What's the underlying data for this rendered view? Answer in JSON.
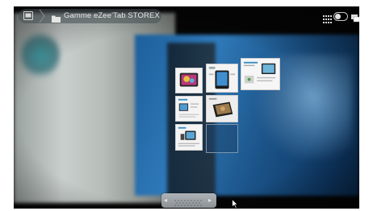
{
  "topbar": {
    "home_icon": "album-icon",
    "separator_icon": "chevron-right-icon",
    "folder_icon": "folder-icon",
    "breadcrumb": "Gamme eZee'Tab STOREX",
    "grid_icon": "grid-view-icon",
    "toggle_icon": "view-toggle",
    "menu_icon": "menu-icon"
  },
  "stack": {
    "thumbnails": [
      {
        "name": "tablet-photo-1"
      },
      {
        "name": "tablet-photo-2"
      },
      {
        "name": "tablet-photo-3"
      },
      {
        "name": "tablet-photo-4"
      },
      {
        "name": "tablet-photo-5"
      },
      {
        "name": "tablet-photo-6"
      },
      {
        "name": "tablet-photo-7"
      }
    ]
  },
  "bottom": {
    "prev_arrow": "◂",
    "next_arrow": "▸"
  },
  "colors": {
    "background_blue": "#1d5f9c",
    "bar_pill": "#464e52",
    "text": "#e8e8e8"
  }
}
